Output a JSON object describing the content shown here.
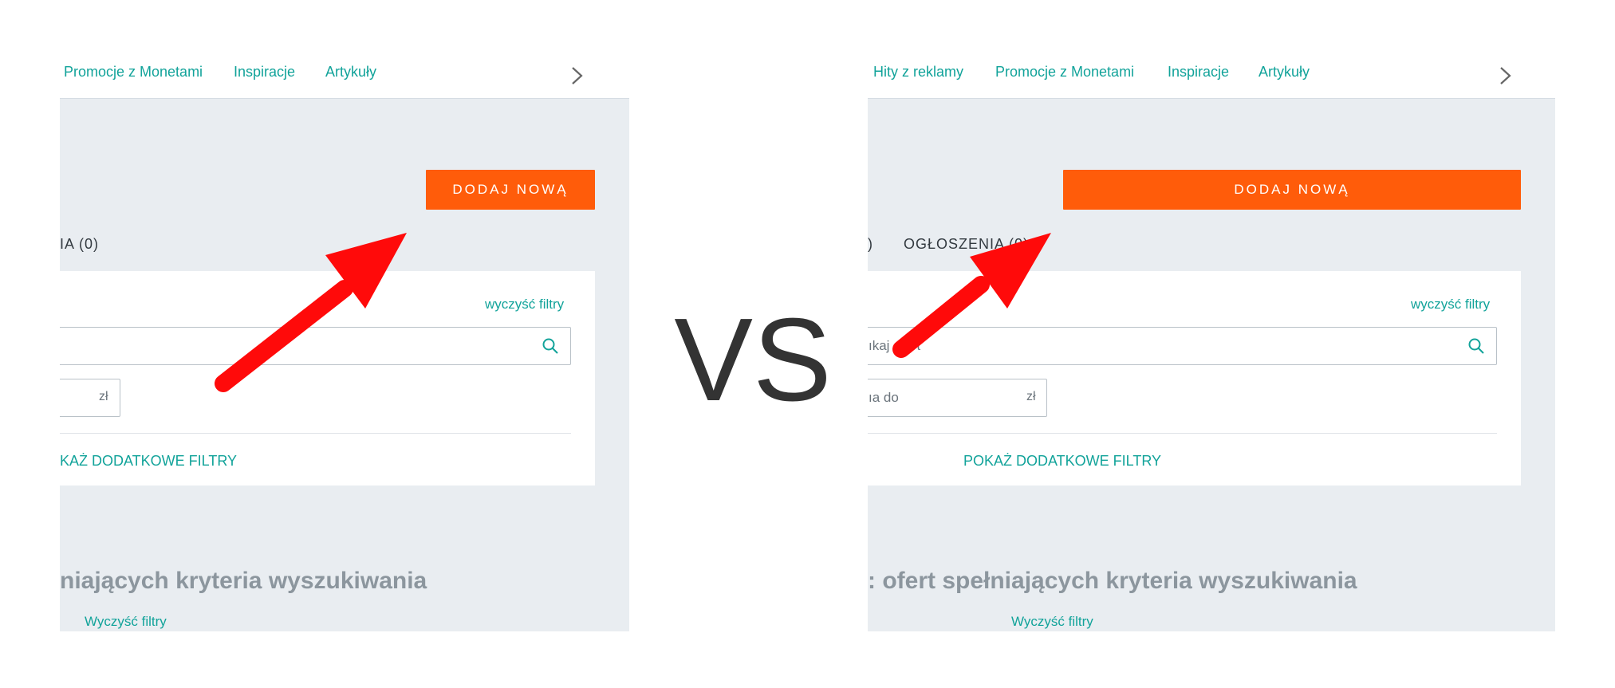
{
  "vs_text": "VS",
  "left": {
    "nav": [
      "Promocje z Monetami",
      "Inspiracje",
      "Artykuły"
    ],
    "add_button": "DODAJ NOWĄ",
    "tab_label": "IA (0)",
    "clear_filters": "wyczyść filtry",
    "search_text": "",
    "price_text": "",
    "price_unit": "zł",
    "more_filters": "KAŻ DODATKOWE FILTRY",
    "results_heading": "niających kryteria wyszukiwania",
    "clear_filters_2": "Wyczyść filtry"
  },
  "right": {
    "nav": [
      "Hity z reklamy",
      "Promocje z Monetami",
      "Inspiracje",
      "Artykuły"
    ],
    "add_button": "DODAJ NOWĄ",
    "tab_prefix": ")",
    "tab_label": "OGŁOSZENIA (0)",
    "clear_filters": "wyczyść filtry",
    "search_text": "ıkaj ofert",
    "price_text": "ıa do",
    "price_unit": "zł",
    "more_filters": "POKAŻ DODATKOWE FILTRY",
    "results_heading": ": ofert spełniających kryteria wyszukiwania",
    "clear_filters_2": "Wyczyść filtry"
  },
  "colors": {
    "accent": "#12a39a",
    "button": "#ff5c0a",
    "arrow": "#ff0000",
    "panel_bg": "#e9edf1"
  },
  "icons": [
    "chevron-right-icon",
    "search-icon",
    "arrow-annotation"
  ]
}
